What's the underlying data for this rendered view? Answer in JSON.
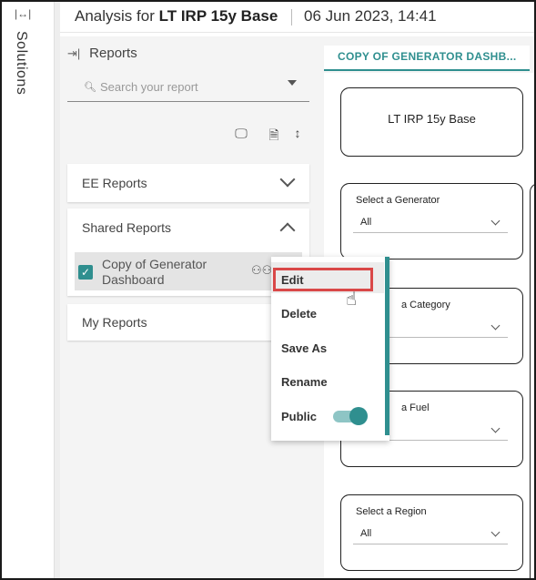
{
  "rail": {
    "toggle_icon": "expand-horizontal-icon",
    "title": "Solutions"
  },
  "header": {
    "title_prefix": "Analysis for ",
    "title_bold": "LT IRP 15y Base",
    "datetime": "06 Jun 2023, 14:41"
  },
  "reports_panel": {
    "heading": "Reports",
    "search_placeholder": "Search your report",
    "sections": [
      {
        "label": "EE Reports",
        "expanded": false
      },
      {
        "label": "Shared Reports",
        "expanded": true,
        "items": [
          {
            "name": "Copy of Generator Dashboard",
            "checked": true
          }
        ]
      },
      {
        "label": "My Reports",
        "expanded": false
      }
    ]
  },
  "context_menu": {
    "items": [
      "Edit",
      "Delete",
      "Save As",
      "Rename",
      "Public"
    ],
    "public_enabled": true,
    "highlighted": "Edit"
  },
  "dashboard": {
    "tab_label": "COPY OF GENERATOR DASHB...",
    "title_card": "LT IRP 15y Base",
    "filters": [
      {
        "label": "Select a Generator",
        "value": "All"
      },
      {
        "label": "a Category",
        "value": ""
      },
      {
        "label": "a Fuel",
        "value": ""
      },
      {
        "label": "Select a Region",
        "value": "All"
      }
    ]
  },
  "colors": {
    "accent": "#2f8f8f",
    "highlight_border": "#d94848"
  }
}
